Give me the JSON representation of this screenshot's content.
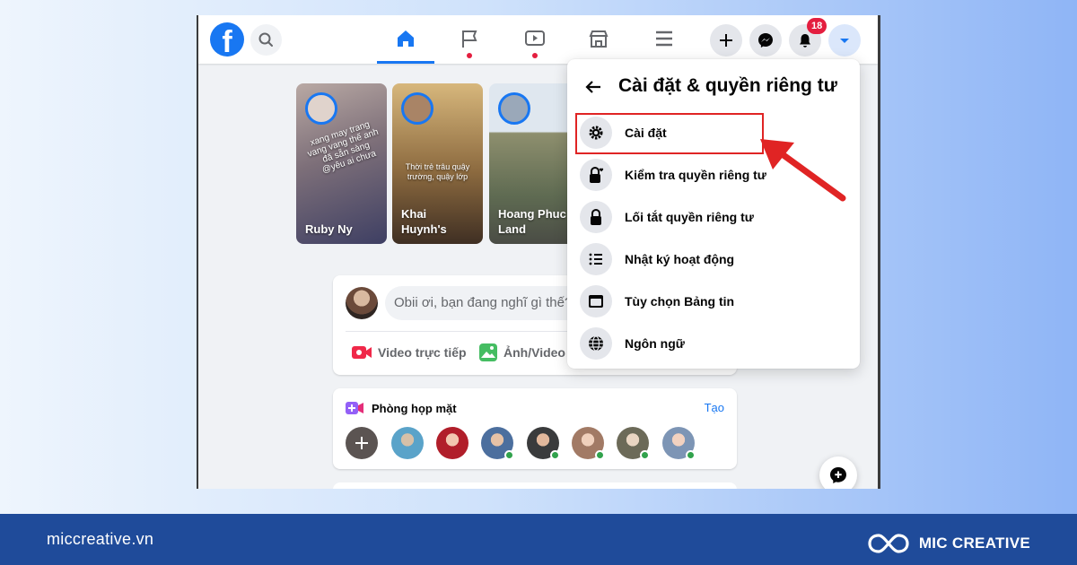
{
  "nav": {
    "logo": "f",
    "notification_count": "18",
    "tabs": [
      "home",
      "pages",
      "watch",
      "marketplace",
      "menu"
    ]
  },
  "stories": [
    {
      "name": "Ruby Ny",
      "caption": "xang may trang\nvang vang thế anh\nđã sẵn sàng\n@yêu ai chưa"
    },
    {
      "name": "Khai\nHuynh's",
      "caption": "Thời trẻ trâu quậy\ntrường, quậy lớp"
    },
    {
      "name": "Hoang Phuc\nLand",
      "caption": ""
    }
  ],
  "composer": {
    "placeholder": "Obii ơi, bạn đang nghĩ gì thế?",
    "live_label": "Video trực tiếp",
    "photo_label": "Ảnh/Video"
  },
  "rooms": {
    "title": "Phòng họp mặt",
    "create_label": "Tạo"
  },
  "menu": {
    "title": "Cài đặt & quyền riêng tư",
    "items": [
      {
        "label": "Cài đặt",
        "icon": "gear-icon"
      },
      {
        "label": "Kiểm tra quyền riêng tư",
        "icon": "lock-heart-icon"
      },
      {
        "label": "Lối tắt quyền riêng tư",
        "icon": "lock-icon"
      },
      {
        "label": "Nhật ký hoạt động",
        "icon": "list-icon"
      },
      {
        "label": "Tùy chọn Bảng tin",
        "icon": "feed-icon"
      },
      {
        "label": "Ngôn ngữ",
        "icon": "globe-icon"
      }
    ]
  },
  "footer": {
    "domain": "miccreative.vn",
    "brand": "MIC CREATIVE"
  },
  "colors": {
    "facebook_blue": "#1877f2",
    "highlight_red": "#e02424",
    "footer_blue": "#1f4b9a"
  }
}
